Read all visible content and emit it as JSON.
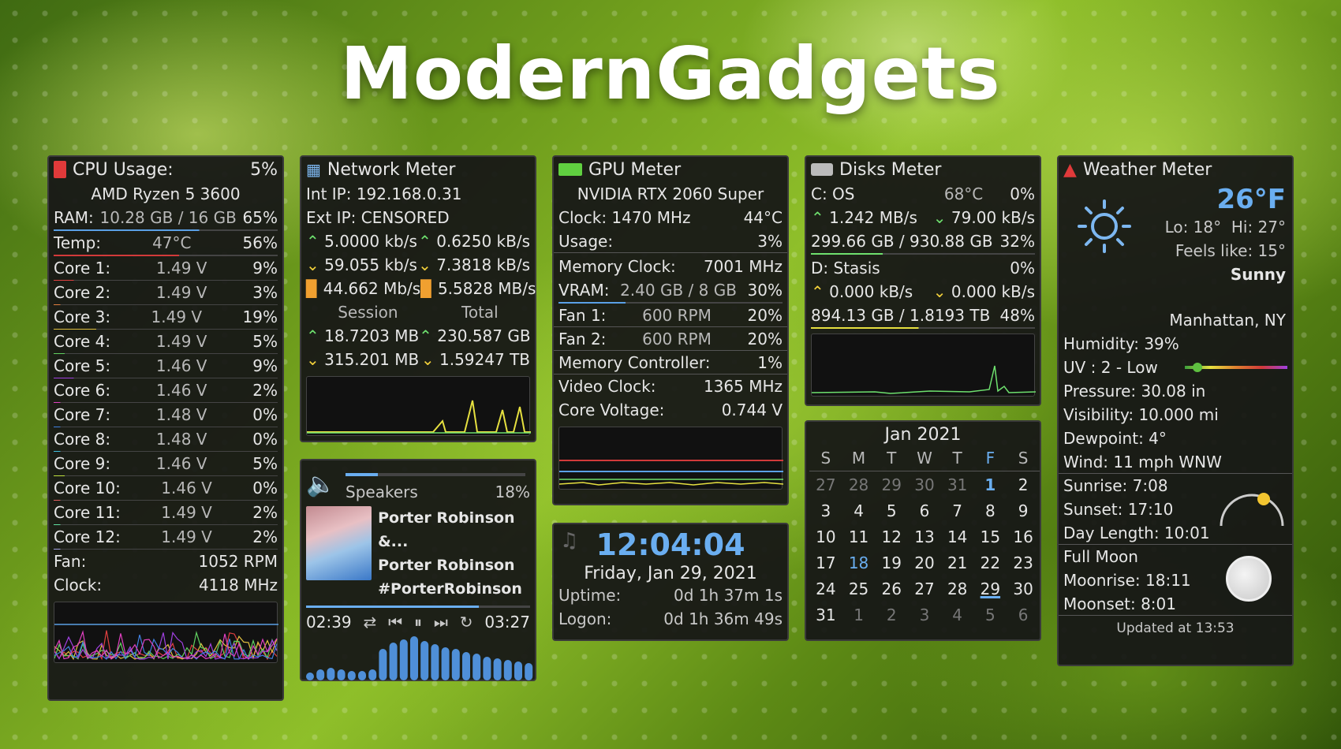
{
  "title": "ModernGadgets",
  "cpu": {
    "header": "CPU Usage:",
    "usage": "5%",
    "model": "AMD Ryzen 5 3600",
    "ram_label": "RAM:",
    "ram_value": "10.28 GB / 16 GB",
    "ram_pct": "65%",
    "temp_label": "Temp:",
    "temp_value": "47°C",
    "temp_pct": "56%",
    "cores": [
      {
        "label": "Core 1:",
        "volt": "1.49 V",
        "pct": "9%",
        "color": "#e04040"
      },
      {
        "label": "Core 2:",
        "volt": "1.49 V",
        "pct": "3%",
        "color": "#e08040"
      },
      {
        "label": "Core 3:",
        "volt": "1.49 V",
        "pct": "19%",
        "color": "#e0c040"
      },
      {
        "label": "Core 4:",
        "volt": "1.49 V",
        "pct": "5%",
        "color": "#60d060"
      },
      {
        "label": "Core 5:",
        "volt": "1.46 V",
        "pct": "9%",
        "color": "#a040e0"
      },
      {
        "label": "Core 6:",
        "volt": "1.46 V",
        "pct": "2%",
        "color": "#e040c0"
      },
      {
        "label": "Core 7:",
        "volt": "1.48 V",
        "pct": "0%",
        "color": "#4080e0"
      },
      {
        "label": "Core 8:",
        "volt": "1.48 V",
        "pct": "0%",
        "color": "#40c0e0"
      },
      {
        "label": "Core 9:",
        "volt": "1.46 V",
        "pct": "5%",
        "color": "#c0e040"
      },
      {
        "label": "Core 10:",
        "volt": "1.46 V",
        "pct": "0%",
        "color": "#e06060"
      },
      {
        "label": "Core 11:",
        "volt": "1.49 V",
        "pct": "2%",
        "color": "#60e0a0"
      },
      {
        "label": "Core 12:",
        "volt": "1.49 V",
        "pct": "2%",
        "color": "#a0a0e0"
      }
    ],
    "fan_label": "Fan:",
    "fan_value": "1052 RPM",
    "clock_label": "Clock:",
    "clock_value": "4118 MHz"
  },
  "network": {
    "header": "Network Meter",
    "int_ip": "Int IP: 192.168.0.31",
    "ext_ip": "Ext IP: CENSORED",
    "up_a": "5.0000 kb/s",
    "up_b": "0.6250 kB/s",
    "down_a": "59.055 kb/s",
    "down_b": "7.3818 kB/s",
    "total_a": "44.662 Mb/s",
    "total_b": "5.5828 MB/s",
    "session_label": "Session",
    "total_label": "Total",
    "s_up": "18.7203 MB",
    "t_up": "230.587 GB",
    "s_down": "315.201 MB",
    "t_down": "1.59247 TB"
  },
  "gpu": {
    "header": "GPU Meter",
    "model": "NVIDIA RTX 2060 Super",
    "clock_label": "Clock: 1470 MHz",
    "temp": "44°C",
    "usage_label": "Usage:",
    "usage": "3%",
    "mem_clock_label": "Memory Clock:",
    "mem_clock": "7001 MHz",
    "vram_label": "VRAM:",
    "vram": "2.40 GB / 8 GB",
    "vram_pct": "30%",
    "fan1_label": "Fan 1:",
    "fan1": "600 RPM",
    "fan1_pct": "20%",
    "fan2_label": "Fan 2:",
    "fan2": "600 RPM",
    "fan2_pct": "20%",
    "memctrl_label": "Memory Controller:",
    "memctrl": "1%",
    "video_clock_label": "Video Clock:",
    "video_clock": "1365 MHz",
    "core_voltage_label": "Core Voltage:",
    "core_voltage": "0.744 V"
  },
  "disks": {
    "header": "Disks Meter",
    "c_label": "C: OS",
    "c_temp": "68°C",
    "c_pct": "0%",
    "c_up": "1.242 MB/s",
    "c_down": "79.00 kB/s",
    "c_space": "299.66 GB / 930.88 GB",
    "c_space_pct": "32%",
    "d_label": "D: Stasis",
    "d_pct": "0%",
    "d_up": "0.000 kB/s",
    "d_down": "0.000 kB/s",
    "d_space": "894.13 GB / 1.8193 TB",
    "d_space_pct": "48%"
  },
  "weather": {
    "header": "Weather Meter",
    "temp": "26°F",
    "lohi": "Lo: 18°  Hi: 27°",
    "feels": "Feels like: 15°",
    "cond": "Sunny",
    "location": "Manhattan, NY",
    "humidity": "Humidity: 39%",
    "uv": "UV : 2 - Low",
    "uv_level": 0.12,
    "pressure": "Pressure: 30.08 in",
    "visibility": "Visibility: 10.000 mi",
    "dewpoint": "Dewpoint: 4°",
    "wind": "Wind: 11 mph WNW",
    "sunrise": "Sunrise: 7:08",
    "sunset": "Sunset: 17:10",
    "daylength": "Day Length: 10:01",
    "moon": "Full Moon",
    "moonrise": "Moonrise: 18:11",
    "moonset": "Moonset: 8:01",
    "updated": "Updated at 13:53"
  },
  "player": {
    "device": "Speakers",
    "volume": "18%",
    "volume_level": 0.18,
    "track": "Porter Robinson &...",
    "artist": "Porter Robinson",
    "album": "#PorterRobinson",
    "elapsed": "02:39",
    "duration": "03:27",
    "progress": 0.77
  },
  "clock": {
    "time": "12:04:04",
    "date": "Friday, Jan 29, 2021",
    "uptime_label": "Uptime:",
    "uptime": "0d 1h 37m 1s",
    "logon_label": "Logon:",
    "logon": "0d 1h 36m 49s"
  },
  "calendar": {
    "month": "Jan 2021",
    "weekdays": [
      "S",
      "M",
      "T",
      "W",
      "T",
      "F",
      "S"
    ],
    "weeks": [
      [
        "27",
        "28",
        "29",
        "30",
        "31",
        "1",
        "2"
      ],
      [
        "3",
        "4",
        "5",
        "6",
        "7",
        "8",
        "9"
      ],
      [
        "10",
        "11",
        "12",
        "13",
        "14",
        "15",
        "16"
      ],
      [
        "17",
        "18",
        "19",
        "20",
        "21",
        "22",
        "23"
      ],
      [
        "24",
        "25",
        "26",
        "27",
        "28",
        "29",
        "30"
      ],
      [
        "31",
        "1",
        "2",
        "3",
        "4",
        "5",
        "6"
      ]
    ]
  }
}
